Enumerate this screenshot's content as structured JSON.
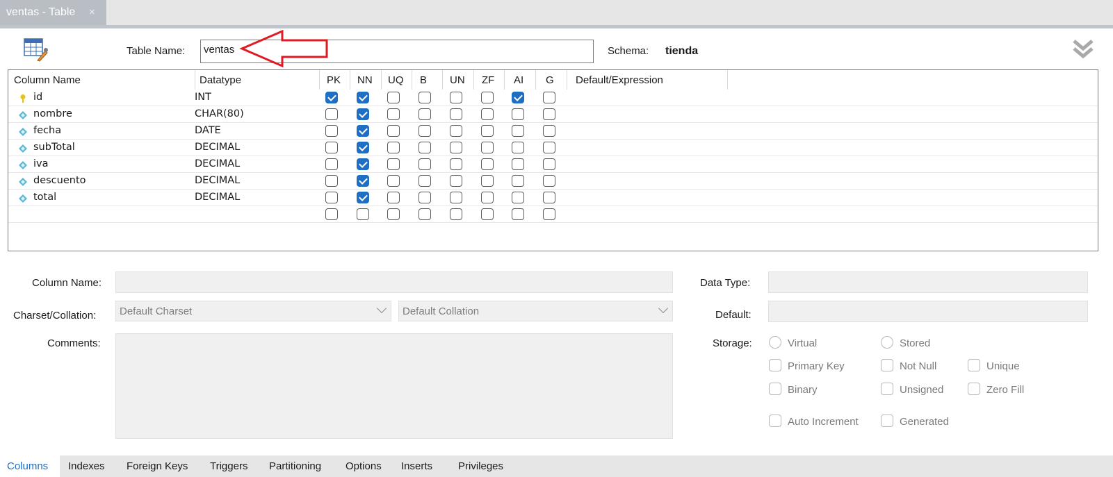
{
  "tab": {
    "title": "ventas - Table",
    "close_glyph": "×"
  },
  "header": {
    "table_name_label": "Table Name:",
    "table_name_value": "ventas",
    "schema_label": "Schema:",
    "schema_value": "tienda"
  },
  "grid": {
    "headers": {
      "name": "Column Name",
      "datatype": "Datatype",
      "pk": "PK",
      "nn": "NN",
      "uq": "UQ",
      "b": "B",
      "un": "UN",
      "zf": "ZF",
      "ai": "AI",
      "g": "G",
      "default": "Default/Expression"
    },
    "rows": [
      {
        "name": "id",
        "datatype": "INT",
        "icon": "key-icon",
        "flags": [
          true,
          true,
          false,
          false,
          false,
          false,
          true,
          false
        ]
      },
      {
        "name": "nombre",
        "datatype": "CHAR(80)",
        "icon": "column-diamond-icon",
        "flags": [
          false,
          true,
          false,
          false,
          false,
          false,
          false,
          false
        ]
      },
      {
        "name": "fecha",
        "datatype": "DATE",
        "icon": "column-diamond-icon",
        "flags": [
          false,
          true,
          false,
          false,
          false,
          false,
          false,
          false
        ]
      },
      {
        "name": "subTotal",
        "datatype": "DECIMAL",
        "icon": "column-diamond-icon",
        "flags": [
          false,
          true,
          false,
          false,
          false,
          false,
          false,
          false
        ]
      },
      {
        "name": "iva",
        "datatype": "DECIMAL",
        "icon": "column-diamond-icon",
        "flags": [
          false,
          true,
          false,
          false,
          false,
          false,
          false,
          false
        ]
      },
      {
        "name": "descuento",
        "datatype": "DECIMAL",
        "icon": "column-diamond-icon",
        "flags": [
          false,
          true,
          false,
          false,
          false,
          false,
          false,
          false
        ]
      },
      {
        "name": "total",
        "datatype": "DECIMAL",
        "icon": "column-diamond-icon",
        "flags": [
          false,
          true,
          false,
          false,
          false,
          false,
          false,
          false
        ]
      },
      {
        "name": "",
        "datatype": "",
        "icon": "",
        "flags": [
          false,
          false,
          false,
          false,
          false,
          false,
          false,
          false
        ]
      }
    ]
  },
  "details": {
    "column_name_label": "Column Name:",
    "charset_label": "Charset/Collation:",
    "charset_value": "Default Charset",
    "collation_value": "Default Collation",
    "comments_label": "Comments:",
    "data_type_label": "Data Type:",
    "default_label": "Default:",
    "storage_label": "Storage:",
    "virtual": "Virtual",
    "stored": "Stored",
    "primary_key": "Primary Key",
    "not_null": "Not Null",
    "unique": "Unique",
    "binary": "Binary",
    "unsigned": "Unsigned",
    "zero_fill": "Zero Fill",
    "auto_increment": "Auto Increment",
    "generated": "Generated"
  },
  "bottom_tabs": [
    "Columns",
    "Indexes",
    "Foreign Keys",
    "Triggers",
    "Partitioning",
    "Options",
    "Inserts",
    "Privileges"
  ],
  "colors": {
    "accent": "#1e6fc4",
    "annotation_arrow": "#e01b24",
    "key_icon": "#e8c21a",
    "column_icon": "#5bb8d4"
  }
}
